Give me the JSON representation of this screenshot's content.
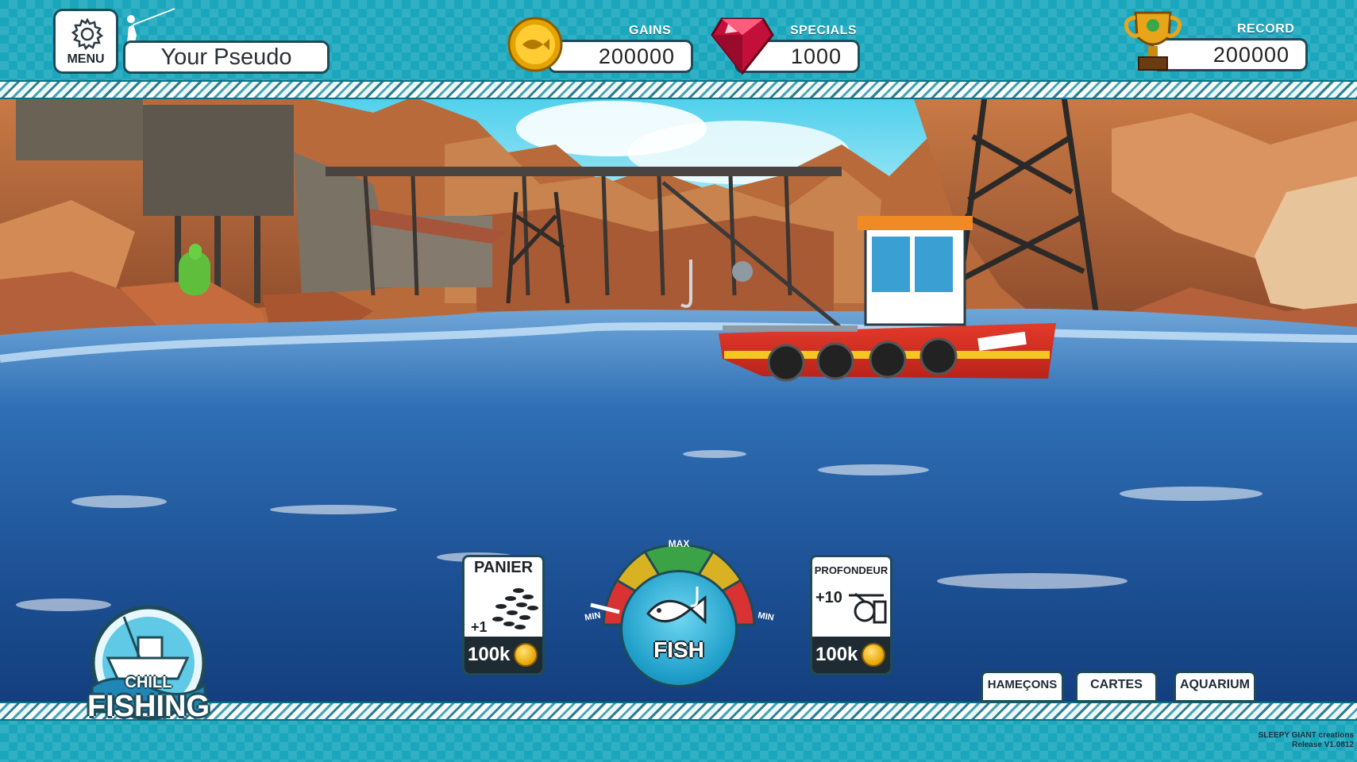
{
  "header": {
    "menu_label": "MENU",
    "player_name": "Your Pseudo",
    "gains": {
      "label": "GAINS",
      "value": "200000"
    },
    "specials": {
      "label": "SPECIALS",
      "value": "1000"
    },
    "record": {
      "label": "RECORD",
      "value": "200000"
    }
  },
  "scene": {
    "boat_name": "CHILL"
  },
  "gauge": {
    "max_label": "MAX",
    "min_left_label": "MIN",
    "min_right_label": "MIN",
    "fish_button_label": "FISH"
  },
  "panier": {
    "title": "PANIER",
    "bonus": "+1",
    "price": "100k"
  },
  "profondeur": {
    "title": "PROFONDEUR",
    "bonus": "+10",
    "price": "100k"
  },
  "tabs": [
    {
      "label": "HAMEÇONS"
    },
    {
      "label": "CARTES"
    },
    {
      "label": "AQUARIUM"
    }
  ],
  "logo": {
    "line1": "CHILL",
    "line2": "FISHING"
  },
  "credit": {
    "studio": "SLEEPY GIANT creations",
    "release": "Release V1.0812"
  },
  "colors": {
    "frame": "#1aa7bd",
    "outline": "#1f4b58",
    "gauge_red": "#d93232",
    "gauge_yellow": "#d9b224",
    "gauge_green": "#3ba345",
    "fish_button": "#2fb6da"
  },
  "icons": [
    "gear-icon",
    "fisherman-icon",
    "coin-icon",
    "ruby-icon",
    "trophy-icon",
    "fish-school-icon",
    "reel-icon",
    "fish-hook-icon"
  ]
}
